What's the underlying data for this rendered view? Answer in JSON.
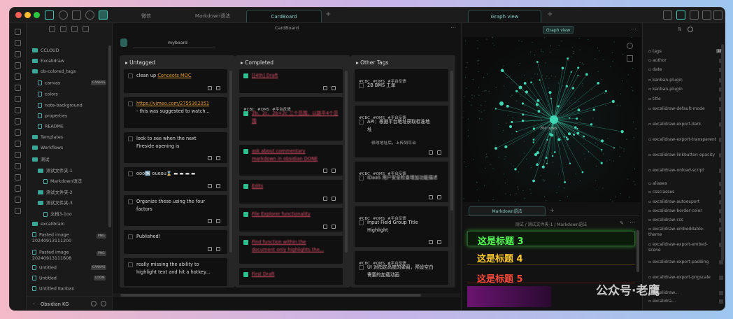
{
  "tabs": {
    "t1": "微信",
    "t2": "Markdown语法",
    "t3": "CardBoard",
    "t4": "Graph view"
  },
  "sidebar": {
    "items": [
      "CCLOUD",
      "Excalidraw",
      "ob-colored_tags",
      "canvas",
      "colors",
      "note-background",
      "properties",
      "README",
      "Templates",
      "Workflows",
      "测试",
      "测试文件夹-1",
      "Markdown语法",
      "测试文件夹-2",
      "测试文件夹-3",
      "文档3-1oo",
      "excalibrain",
      "Pasted image 20240913111200",
      "Pasted image 20240913111608",
      "Untitled",
      "Untitled",
      "Untitled Kanban"
    ],
    "badges": {
      "canvas": "CANVAS",
      "png1": "PNG",
      "png2": "PNG",
      "untitled1": "CANVAS",
      "untitled2": "LOOM"
    },
    "vault": "Obsidian KG"
  },
  "board": {
    "title": "CardBoard",
    "name": "myboard",
    "col1": {
      "title": "Untagged",
      "cards": [
        "clean up",
        "Conceots MOC",
        "https://vimeo.com/2755302051",
        "- this was suggested to watch...",
        "look to see when the next",
        "Fireside opening is",
        "ooo🆗 oueou⌛ ▬ ▬ ▬ ▬",
        "Organize these using the four",
        "factors",
        "Published!",
        "really missing the ability to",
        "highlight text and hit a hotkey..."
      ]
    },
    "col2": {
      "title": "Completed",
      "cards": [
        "[[4th] Draft",
        "#CBC",
        "#OMS",
        "#平台反馈",
        "2b、2c、2b+2c 三个范围，以路平4个范围",
        "ask about commentary",
        "markdown in obsidian DONE",
        "Edits",
        "File Explorer functionality",
        "Find function within the",
        "document only highlights the...",
        "First Draft"
      ]
    },
    "col3": {
      "title": "Other Tags",
      "cards": [
        "#CBC",
        "#OMS",
        "#平台反馈",
        "2B BMS 工单",
        "API：根据平台地址获取标准地",
        "址",
        "修改地址后，上传到平台",
        "IDaaS 用户安全检查增加功能描述",
        "Input Field Group Title",
        "Highlight",
        "UI 对指定高度的弹窗，预设空白",
        "需要的加载动画"
      ]
    }
  },
  "graph": {
    "btn": "Graph view",
    "center": "200 index"
  },
  "markdown": {
    "tab": "Markdown语法",
    "crumb": "测试 / 测试文件夹-1 / Markdown语法",
    "h3": "这是标题 3",
    "h4": "这是标题 4",
    "h5": "这是标题 5"
  },
  "tags": {
    "items": [
      "tags",
      "author",
      "date",
      "kanban-plugin",
      "kanban-plugin",
      "title",
      "excalidraw-default-mode",
      "excalidraw-export-dark",
      "excalidraw-export-transparent",
      "excalidraw-linkbutton-opacity",
      "excalidraw-onload-script",
      "aliases",
      "cssclasses",
      "excalidraw-autoexport",
      "excalidraw-border-color",
      "excalidraw-css",
      "excalidraw-embeddable-theme",
      "excalidraw-export-embed-scene",
      "excalidraw-export-padding",
      "excalidraw-export-pngscale",
      "excalidraw...",
      "excalidra..."
    ],
    "counts": [
      "16"
    ]
  },
  "watermark": "公众号·老鹰",
  "colors": {
    "accent": "#3ec7b3",
    "graph": "#3fd6b4"
  }
}
